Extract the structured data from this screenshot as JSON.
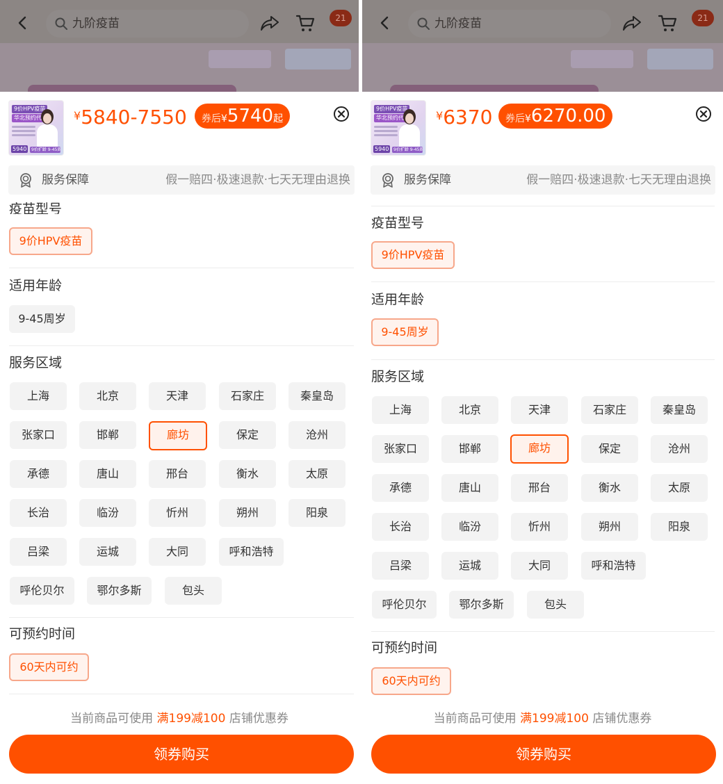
{
  "search": {
    "placeholder": "九阶疫苗"
  },
  "cart_badge": "21",
  "colors": {
    "accent": "#ff5000",
    "sheet_bg": "#ffffff",
    "chip_bg": "#f3f3f3"
  },
  "icons": [
    "back-icon",
    "search-icon",
    "share-icon",
    "cart-icon",
    "close-icon",
    "shield-icon"
  ],
  "thumbnail": {
    "line1": "9价HPV疫苗",
    "line2": "华北预约代订",
    "price_tag": "5940",
    "tag2": "9价扩龄 9-45周岁适用"
  },
  "left": {
    "price_yen": "¥",
    "price_range": "5840-7550",
    "coupon_label": "券后",
    "coupon_yen": "¥",
    "coupon_price": "5740",
    "coupon_suffix": "起"
  },
  "right": {
    "price_yen": "¥",
    "price": "6370",
    "coupon_label": "券后",
    "coupon_yen": "¥",
    "coupon_price": "6270.00"
  },
  "service": {
    "title": "服务保障",
    "desc": "假一赔四·极速退款·七天无理由退换"
  },
  "sections": {
    "vaccine_type": {
      "title": "疫苗型号",
      "option": "9价HPV疫苗"
    },
    "age": {
      "title": "适用年龄",
      "option": "9-45周岁"
    },
    "region": {
      "title": "服务区域",
      "options": [
        "上海",
        "北京",
        "天津",
        "石家庄",
        "秦皇岛",
        "张家口",
        "邯郸",
        "廊坊",
        "保定",
        "沧州",
        "承德",
        "唐山",
        "邢台",
        "衡水",
        "太原",
        "长治",
        "临汾",
        "忻州",
        "朔州",
        "阳泉",
        "吕梁",
        "运城",
        "大同",
        "呼和浩特",
        "呼伦贝尔",
        "鄂尔多斯",
        "包头"
      ],
      "selected": "廊坊"
    },
    "time": {
      "title": "可预约时间",
      "option": "60天内可约"
    }
  },
  "coupon_note": {
    "prefix": "当前商品可使用",
    "highlight": "满199减100",
    "suffix": "店铺优惠券"
  },
  "buy_button": "领券购买"
}
